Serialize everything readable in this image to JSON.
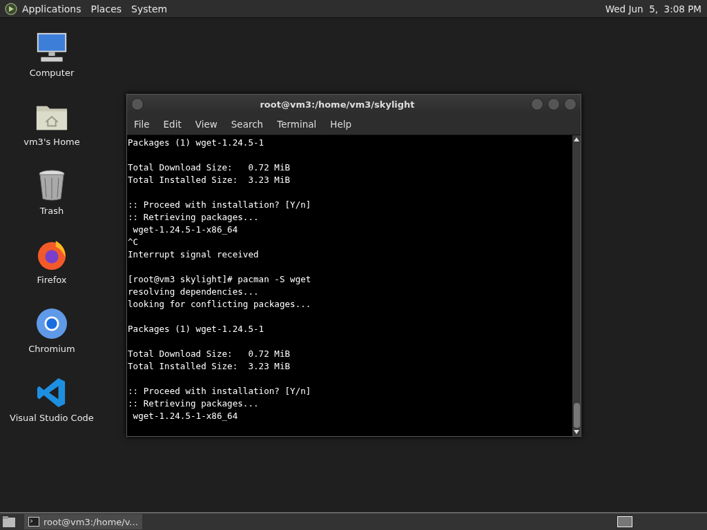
{
  "top_panel": {
    "menus": [
      "Applications",
      "Places",
      "System"
    ],
    "clock": "Wed Jun  5,  3:08 PM"
  },
  "desktop_icons": [
    {
      "kind": "computer",
      "label": "Computer"
    },
    {
      "kind": "home",
      "label": "vm3's Home"
    },
    {
      "kind": "trash",
      "label": "Trash"
    },
    {
      "kind": "firefox",
      "label": "Firefox"
    },
    {
      "kind": "chromium",
      "label": "Chromium"
    },
    {
      "kind": "vscode",
      "label": "Visual Studio Code"
    }
  ],
  "terminal": {
    "title": "root@vm3:/home/vm3/skylight",
    "menu": [
      "File",
      "Edit",
      "View",
      "Search",
      "Terminal",
      "Help"
    ],
    "paragraphs": [
      [
        "Packages (1) wget-1.24.5-1"
      ],
      [
        "Total Download Size:   0.72 MiB",
        "Total Installed Size:  3.23 MiB"
      ],
      [
        ":: Proceed with installation? [Y/n]",
        ":: Retrieving packages...",
        " wget-1.24.5-1-x86_64",
        "^C",
        "Interrupt signal received"
      ],
      [
        "[root@vm3 skylight]# pacman -S wget",
        "resolving dependencies...",
        "looking for conflicting packages..."
      ],
      [
        "Packages (1) wget-1.24.5-1"
      ],
      [
        "Total Download Size:   0.72 MiB",
        "Total Installed Size:  3.23 MiB"
      ],
      [
        ":: Proceed with installation? [Y/n]",
        ":: Retrieving packages...",
        " wget-1.24.5-1-x86_64"
      ]
    ]
  },
  "taskbar": {
    "tasks": [
      {
        "label": "root@vm3:/home/v...",
        "selected": true
      }
    ]
  }
}
